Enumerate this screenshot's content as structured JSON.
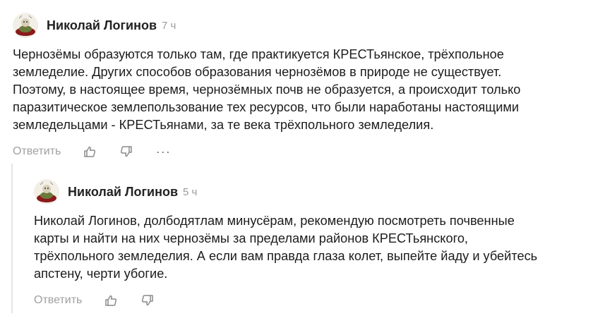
{
  "comments": [
    {
      "author": "Николай Логинов",
      "time": "7 ч",
      "text": "Чернозёмы образуются только там, где практикуется КРЕСТьянское, трёхпольное\nземледелие. Других способов образования чернозёмов в природе не существует.\nПоэтому, в настоящее время, чернозёмных почв не образуется, а происходит только\nпаразитическое землепользование тех ресурсов, что были наработаны настоящими\nземледельцами - КРЕСТьянами, за те века трёхпольного земледелия.",
      "reply_label": "Ответить",
      "more_label": "···"
    },
    {
      "author": "Николай Логинов",
      "time": "5 ч",
      "text": "Николай Логинов, долбодятлам минусёрам, рекомендую посмотреть почвенные\nкарты и найти на них чернозёмы за пределами районов КРЕСТьянского,\nтрёхпольного земледелия. А если вам правда глаза колет, выпейте йаду и убейтесь\nапстену, черти убогие.",
      "reply_label": "Ответить"
    }
  ],
  "icons": {
    "like": "thumbs-up-icon",
    "dislike": "thumbs-down-icon",
    "more": "more-dots-icon"
  },
  "colors": {
    "muted": "#a0a0a0",
    "thread_line": "#e4e4e4"
  }
}
